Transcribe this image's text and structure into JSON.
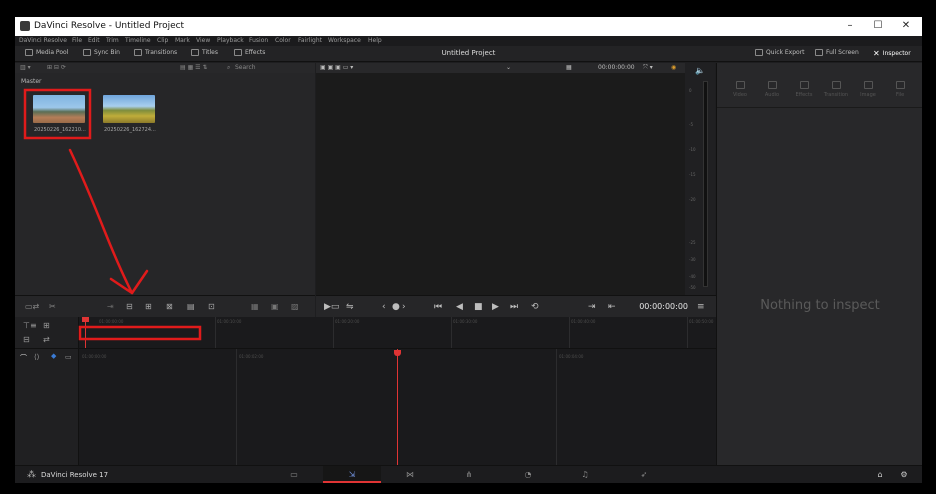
{
  "window": {
    "title": "DaVinci Resolve - Untitled Project"
  },
  "menu": [
    "DaVinci Resolve",
    "File",
    "Edit",
    "Trim",
    "Timeline",
    "Clip",
    "Mark",
    "View",
    "Playback",
    "Fusion",
    "Color",
    "Fairlight",
    "Workspace",
    "Help"
  ],
  "toolbar": {
    "media_pool": "Media Pool",
    "sync_bin": "Sync Bin",
    "transitions": "Transitions",
    "titles": "Titles",
    "effects": "Effects",
    "project_title": "Untitled Project",
    "quick_export": "Quick Export",
    "full_screen": "Full Screen",
    "inspector": "Inspector"
  },
  "media_pool": {
    "search_placeholder": "Search",
    "bin": "Master",
    "clips": [
      {
        "name": "20250226_162210..."
      },
      {
        "name": "20250226_162724..."
      }
    ]
  },
  "viewer": {
    "timecode": "00:00:00:00",
    "transport_timecode": "00:00:00:00"
  },
  "meters": {
    "labels": [
      "0",
      "-5",
      "-10",
      "-15",
      "-20",
      "-25",
      "-30",
      "-40",
      "-50"
    ]
  },
  "inspector": {
    "tabs": [
      "Video",
      "Audio",
      "Effects",
      "Transition",
      "Image",
      "File"
    ],
    "empty_message": "Nothing to inspect"
  },
  "timeline": {
    "ruler_top": [
      "01:00:00:00",
      "01:00:10:00",
      "01:00:20:00",
      "01:00:30:00",
      "01:00:40:00",
      "01:00:50:00"
    ],
    "ruler_bottom": [
      "01:00:00:00",
      "01:00:02:00",
      "01:00:04:00"
    ]
  },
  "bottom": {
    "app_name": "DaVinci Resolve 17"
  },
  "colors": {
    "annotation_red": "#e01b1b",
    "playhead": "#e03434",
    "active_page": "#e03434"
  }
}
